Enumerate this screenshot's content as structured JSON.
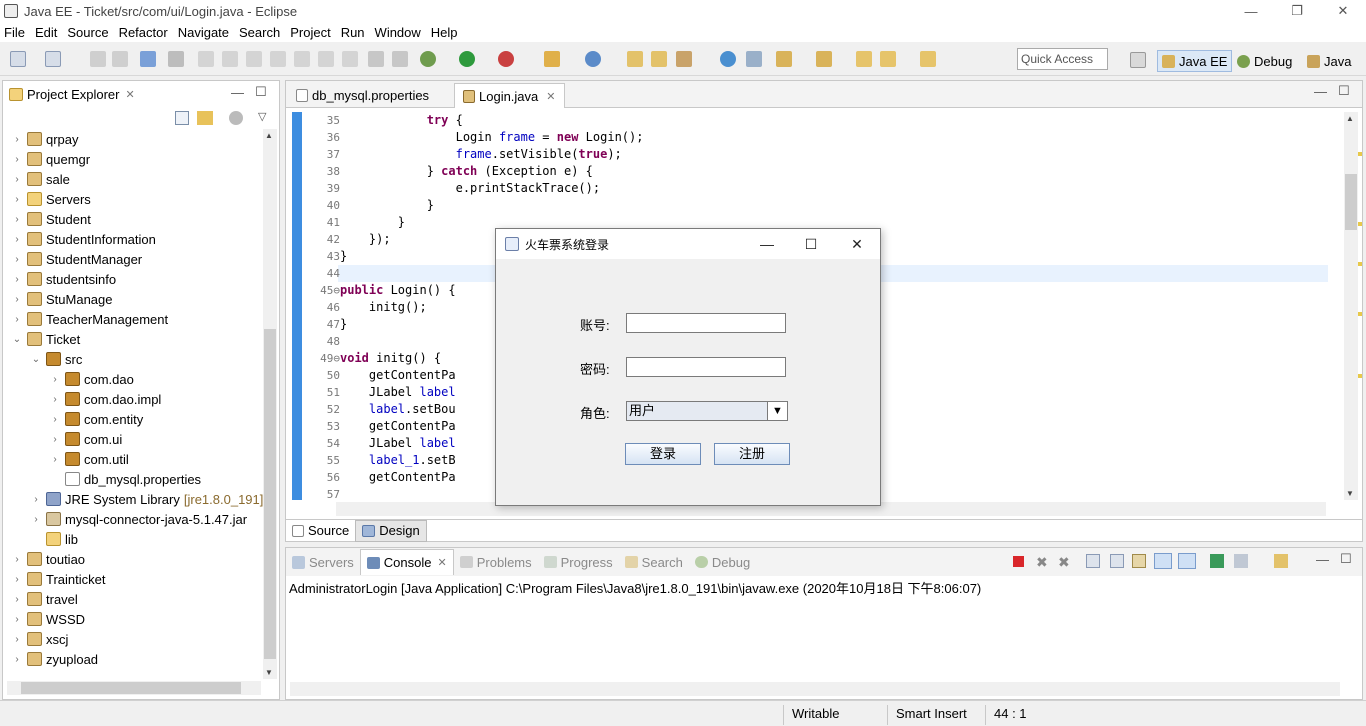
{
  "window": {
    "title": "Java EE - Ticket/src/com/ui/Login.java - Eclipse",
    "minimize": "—",
    "maximize": "❐",
    "close": "✕"
  },
  "menu": [
    "File",
    "Edit",
    "Source",
    "Refactor",
    "Navigate",
    "Search",
    "Project",
    "Run",
    "Window",
    "Help"
  ],
  "quick_access": "Quick Access",
  "perspectives": [
    {
      "label": "Java EE"
    },
    {
      "label": "Debug"
    },
    {
      "label": "Java"
    }
  ],
  "explorer": {
    "title": "Project Explorer",
    "items": [
      {
        "label": "qrpay",
        "depth": 0,
        "expand": "collapsed",
        "icon": "project"
      },
      {
        "label": "quemgr",
        "depth": 0,
        "expand": "collapsed",
        "icon": "project"
      },
      {
        "label": "sale",
        "depth": 0,
        "expand": "collapsed",
        "icon": "project"
      },
      {
        "label": "Servers",
        "depth": 0,
        "expand": "collapsed",
        "icon": "folder"
      },
      {
        "label": "Student",
        "depth": 0,
        "expand": "collapsed",
        "icon": "project"
      },
      {
        "label": "StudentInformation",
        "depth": 0,
        "expand": "collapsed",
        "icon": "project"
      },
      {
        "label": "StudentManager",
        "depth": 0,
        "expand": "collapsed",
        "icon": "project"
      },
      {
        "label": "studentsinfo",
        "depth": 0,
        "expand": "collapsed",
        "icon": "project"
      },
      {
        "label": "StuManage",
        "depth": 0,
        "expand": "collapsed",
        "icon": "project"
      },
      {
        "label": "TeacherManagement",
        "depth": 0,
        "expand": "collapsed",
        "icon": "project"
      },
      {
        "label": "Ticket",
        "depth": 0,
        "expand": "expanded",
        "icon": "project"
      },
      {
        "label": "src",
        "depth": 1,
        "expand": "expanded",
        "icon": "package"
      },
      {
        "label": "com.dao",
        "depth": 2,
        "expand": "collapsed",
        "icon": "package"
      },
      {
        "label": "com.dao.impl",
        "depth": 2,
        "expand": "collapsed",
        "icon": "package"
      },
      {
        "label": "com.entity",
        "depth": 2,
        "expand": "collapsed",
        "icon": "package"
      },
      {
        "label": "com.ui",
        "depth": 2,
        "expand": "collapsed",
        "icon": "package"
      },
      {
        "label": "com.util",
        "depth": 2,
        "expand": "collapsed",
        "icon": "package"
      },
      {
        "label": "db_mysql.properties",
        "depth": 2,
        "expand": "none",
        "icon": "file"
      },
      {
        "label": "JRE System Library",
        "suffix": "[jre1.8.0_191]",
        "depth": 1,
        "expand": "collapsed",
        "icon": "library"
      },
      {
        "label": "mysql-connector-java-5.1.47.jar",
        "depth": 1,
        "expand": "collapsed",
        "icon": "jar"
      },
      {
        "label": "lib",
        "depth": 1,
        "expand": "none",
        "icon": "folder"
      },
      {
        "label": "toutiao",
        "depth": 0,
        "expand": "collapsed",
        "icon": "project"
      },
      {
        "label": "Trainticket",
        "depth": 0,
        "expand": "collapsed",
        "icon": "project"
      },
      {
        "label": "travel",
        "depth": 0,
        "expand": "collapsed",
        "icon": "project"
      },
      {
        "label": "WSSD",
        "depth": 0,
        "expand": "collapsed",
        "icon": "project"
      },
      {
        "label": "xscj",
        "depth": 0,
        "expand": "collapsed",
        "icon": "project"
      },
      {
        "label": "zyupload",
        "depth": 0,
        "expand": "collapsed",
        "icon": "project"
      }
    ]
  },
  "editor": {
    "tabs": [
      {
        "label": "db_mysql.properties",
        "active": false
      },
      {
        "label": "Login.java",
        "active": true
      }
    ],
    "lines": [
      {
        "n": "35",
        "code": "            try {"
      },
      {
        "n": "36",
        "code": "                Login frame = new Login();"
      },
      {
        "n": "37",
        "code": "                frame.setVisible(true);"
      },
      {
        "n": "38",
        "code": "            } catch (Exception e) {"
      },
      {
        "n": "39",
        "code": "                e.printStackTrace();"
      },
      {
        "n": "40",
        "code": "            }"
      },
      {
        "n": "41",
        "code": "        }"
      },
      {
        "n": "42",
        "code": "    });"
      },
      {
        "n": "43",
        "code": "}"
      },
      {
        "n": "44",
        "code": ""
      },
      {
        "n": "45⊖",
        "code": "public Login() {"
      },
      {
        "n": "46",
        "code": "    initg();"
      },
      {
        "n": "47",
        "code": "}"
      },
      {
        "n": "48",
        "code": ""
      },
      {
        "n": "49⊖",
        "code": "void initg() {"
      },
      {
        "n": "50",
        "code": "    getContentPa"
      },
      {
        "n": "51",
        "code": "    JLabel label"
      },
      {
        "n": "52",
        "code": "    label.setBou"
      },
      {
        "n": "53",
        "code": "    getContentPa"
      },
      {
        "n": "54",
        "code": "    JLabel label"
      },
      {
        "n": "55",
        "code": "    label_1.setB"
      },
      {
        "n": "56",
        "code": "    getContentPa"
      },
      {
        "n": "57",
        "code": ""
      }
    ],
    "bottom_tabs": [
      {
        "label": "Source"
      },
      {
        "label": "Design"
      }
    ]
  },
  "console": {
    "tabs": [
      {
        "label": "Servers"
      },
      {
        "label": "Console"
      },
      {
        "label": "Problems"
      },
      {
        "label": "Progress"
      },
      {
        "label": "Search"
      },
      {
        "label": "Debug"
      }
    ],
    "line": "AdministratorLogin [Java Application] C:\\Program Files\\Java8\\jre1.8.0_191\\bin\\javaw.exe (2020年10月18日 下午8:06:07)"
  },
  "status": {
    "writable": "Writable",
    "insert": "Smart Insert",
    "position": "44 : 1"
  },
  "dialog": {
    "title": "火车票系统登录",
    "account_label": "账号:",
    "password_label": "密码:",
    "role_label": "角色:",
    "role_value": "用户",
    "login_button": "登录",
    "register_button": "注册",
    "minimize": "—",
    "maximize": "☐",
    "close": "✕"
  },
  "colors": {
    "accent": "#3d8de0",
    "keyword": "#7f0055",
    "field": "#0000c0"
  }
}
